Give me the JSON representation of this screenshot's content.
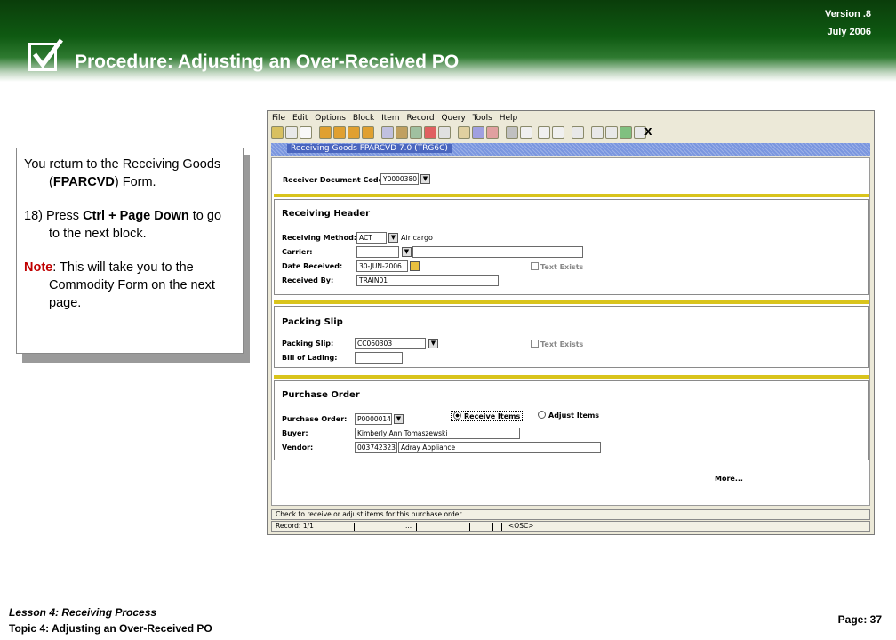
{
  "header": {
    "version": "Version .8",
    "date": "July  2006",
    "title": "Procedure:  Adjusting an Over-Received PO"
  },
  "callout": {
    "intro_line1": "You return to the Receiving Goods",
    "intro_open": "(",
    "intro_form": "FPARCVD",
    "intro_close": ") Form.",
    "step_prefix": "18) Press ",
    "step_key": "Ctrl + Page Down",
    "step_suffix": " to go to the next block.",
    "note_label": "Note",
    "note_text": ":  This will take you to the Commodity Form on the next page."
  },
  "app": {
    "menu": [
      "File",
      "Edit",
      "Options",
      "Block",
      "Item",
      "Record",
      "Query",
      "Tools",
      "Help"
    ],
    "toolbar_close": "X",
    "form_title": "Receiving Goods  FPARCVD  7.0  (TRG6C)",
    "receiver_doc_label": "Receiver Document Code:",
    "receiver_doc_value": "Y0000380",
    "receiving_header": {
      "title": "Receiving Header",
      "method_label": "Receiving Method:",
      "method_value": "ACT",
      "method_desc": "Air cargo",
      "carrier_label": "Carrier:",
      "date_label": "Date Received:",
      "date_value": "30-JUN-2006",
      "received_by_label": "Received By:",
      "received_by_value": "TRAIN01",
      "text_exists": "Text Exists"
    },
    "packing_slip": {
      "title": "Packing Slip",
      "slip_label": "Packing Slip:",
      "slip_value": "CC060303",
      "lading_label": "Bill of Lading:",
      "text_exists": "Text Exists"
    },
    "purchase_order": {
      "title": "Purchase Order",
      "po_label": "Purchase Order:",
      "po_value": "P0000014",
      "receive_items": "Receive Items",
      "adjust_items": "Adjust Items",
      "buyer_label": "Buyer:",
      "buyer_value": "Kimberly Ann  Tomaszewski",
      "vendor_label": "Vendor:",
      "vendor_id": "003742323",
      "vendor_name": "Adray Appliance"
    },
    "more": "More...",
    "status_message": "Check to receive or adjust items for this purchase order",
    "record": "Record: 1/1",
    "ellipsis": "...",
    "osc": "<OSC>"
  },
  "footer": {
    "lesson": "Lesson 4: Receiving Process",
    "topic": "Topic 4: Adjusting an Over-Received  PO",
    "page": "Page: 37"
  }
}
